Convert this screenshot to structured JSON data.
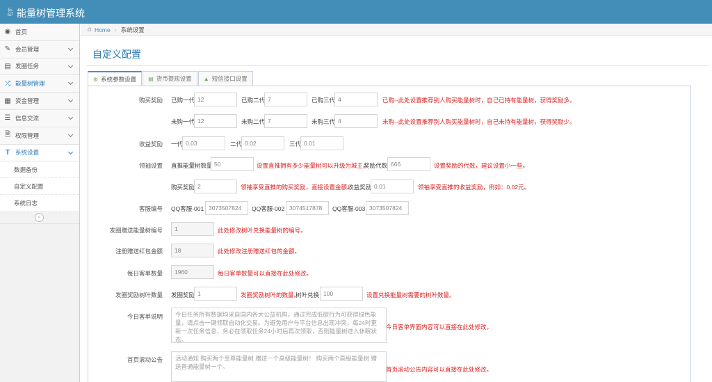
{
  "app": {
    "title": "能量树管理系统"
  },
  "sidebar": {
    "items": [
      {
        "label": "首页"
      },
      {
        "label": "会员管理"
      },
      {
        "label": "发圈任务"
      },
      {
        "label": "能量树管理"
      },
      {
        "label": "资金管理"
      },
      {
        "label": "信息交流"
      },
      {
        "label": "权限管理"
      },
      {
        "label": "系统设置"
      }
    ],
    "subitems": [
      {
        "label": "数据备份"
      },
      {
        "label": "自定义配置"
      },
      {
        "label": "系统日志"
      }
    ]
  },
  "breadcrumb": {
    "home": "Home",
    "current": "系统设置"
  },
  "page": {
    "title": "自定义配置"
  },
  "tabs": [
    {
      "label": "系统参数设置"
    },
    {
      "label": "货币提现设置"
    },
    {
      "label": "短信接口设置"
    }
  ],
  "form": {
    "buy_reward": {
      "label": "购买奖励",
      "bought": [
        {
          "label": "已购一代",
          "value": "12"
        },
        {
          "label": "已购二代",
          "value": "7"
        },
        {
          "label": "已购三代",
          "value": "4"
        }
      ],
      "bought_hint": "已购--此处设置推荐别人购买能量树时，自己已持有能量树，获得奖励多。",
      "unbought": [
        {
          "label": "未购一代",
          "value": "12"
        },
        {
          "label": "未购二代",
          "value": "7"
        },
        {
          "label": "未购三代",
          "value": "4"
        }
      ],
      "unbought_hint": "未购--此处设置推荐别人购买能量树时，自己未持有能量树，获得奖励少。"
    },
    "income_reward": {
      "label": "收益奖励",
      "items": [
        {
          "label": "一代",
          "value": "0.03"
        },
        {
          "label": "二代",
          "value": "0.02"
        },
        {
          "label": "三代",
          "value": "0.01"
        }
      ]
    },
    "leader": {
      "label": "领袖设置",
      "direct_label": "直推能量树数量",
      "direct_value": "50",
      "direct_hint": "设置直推拥有多少能量树可以升级为城主。",
      "gen_label": "奖励代数",
      "gen_value": "666",
      "gen_hint": "设置奖励的代数，建议设置小一些。",
      "buy_label": "购买奖励",
      "buy_value": "2",
      "buy_hint": "领袖享受直推的购买奖励，直接设置金额。",
      "income_label": "收益奖励",
      "income_value": "0.01",
      "income_hint": "领袖享受直推的收益奖励，例如：0.02元。"
    },
    "service": {
      "label": "客服编号",
      "items": [
        {
          "label": "QQ客服-001",
          "value": "3073507824"
        },
        {
          "label": "QQ客服-002",
          "value": "3074517878"
        },
        {
          "label": "QQ客服-003",
          "value": "3073507824"
        }
      ]
    },
    "share_tree": {
      "label": "发圈赠送能量树编号",
      "value": "1",
      "hint": "此处修改树叶兑换能量树的编号。"
    },
    "register_bonus": {
      "label": "注册赠送红包金额",
      "value": "18",
      "hint": "此处修改注册赠送红包的金额。"
    },
    "daily_count": {
      "label": "每日客单数量",
      "value": "1960",
      "hint": "每日客单数量可以直接在此处修改。"
    },
    "share_leaf": {
      "label": "发圈奖励树叶数量",
      "reward_label": "发圈奖励",
      "reward_value": "1",
      "reward_hint": "发圈奖励树叶的数量。",
      "exchange_label": "树叶兑换",
      "exchange_value": "100",
      "exchange_hint": "设置兑换能量树需要的树叶数量。"
    },
    "daily_desc": {
      "label": "今日客单说明",
      "value": "今日任务所有数据均采自国内各大公益机构，通过完成低碳行为可获得绿色能量，请点击一键领取自动化交易。为避免用户与平台信息出现冲突，每24时更新一次任务信息，务必在领取任务24小时后再次领取，否则能量树进入休眠状态。",
      "hint": "今日客单界面内容可以直接在此处修改。"
    },
    "scroll_notice": {
      "label": "首页滚动公告",
      "value": "活动通知 购买两个至尊能量树 赠送一个高级能量树！ 购买两个高级能量树 赠送普通能量树一个。",
      "hint": "首页滚动公告内容可以直接在此处修改。"
    }
  }
}
